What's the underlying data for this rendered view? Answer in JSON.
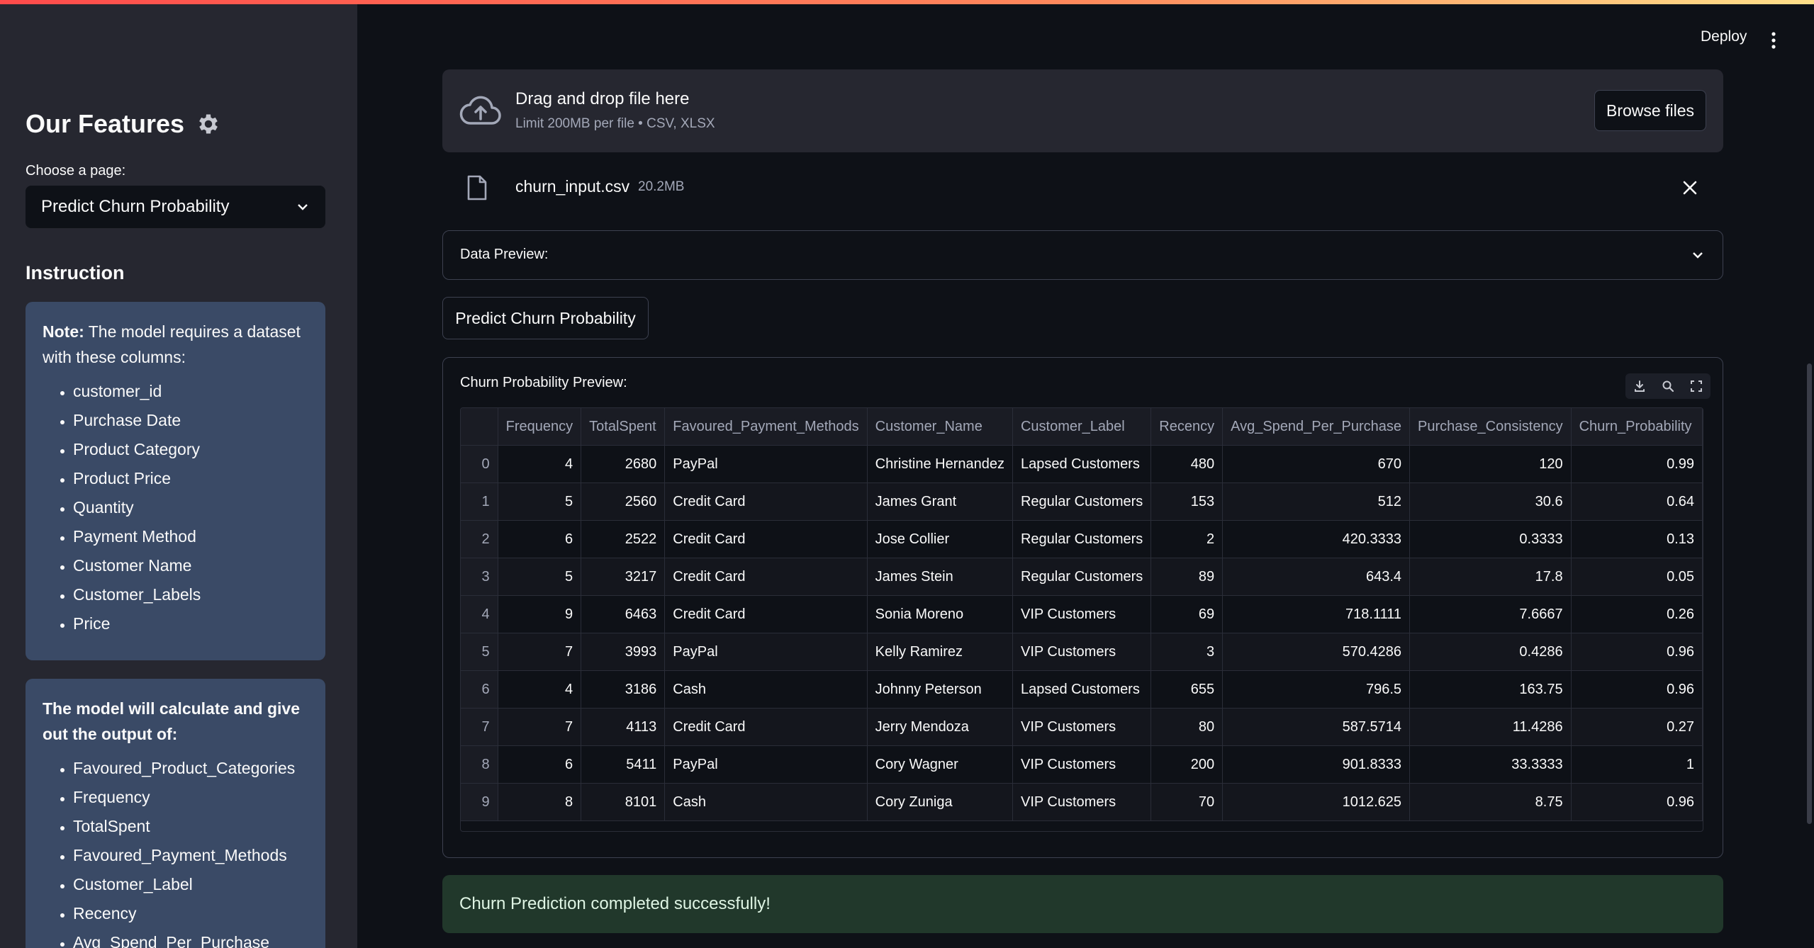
{
  "header": {
    "deploy_label": "Deploy"
  },
  "sidebar": {
    "title": "Our Features",
    "choose_label": "Choose a page:",
    "selected_page": "Predict Churn Probability",
    "instruction_heading": "Instruction",
    "note_prefix": "Note:",
    "note_text": " The model requires a dataset with these columns:",
    "required_columns": [
      "customer_id",
      "Purchase Date",
      "Product Category",
      "Product Price",
      "Quantity",
      "Payment Method",
      "Customer Name",
      "Customer_Labels",
      "Price"
    ],
    "output_heading": "The model will calculate and give out the output of:",
    "output_columns": [
      "Favoured_Product_Categories",
      "Frequency",
      "TotalSpent",
      "Favoured_Payment_Methods",
      "Customer_Label",
      "Recency",
      "Avg_Spend_Per_Purchase"
    ]
  },
  "uploader": {
    "title": "Drag and drop file here",
    "limit": "Limit 200MB per file • CSV, XLSX",
    "browse_label": "Browse files"
  },
  "file": {
    "name": "churn_input.csv",
    "size": "20.2MB"
  },
  "expander": {
    "label": "Data Preview:"
  },
  "predict_button": "Predict Churn Probability",
  "dataframe": {
    "title": "Churn Probability Preview:",
    "columns": [
      "",
      "Frequency",
      "TotalSpent",
      "Favoured_Payment_Methods",
      "Customer_Name",
      "Customer_Label",
      "Recency",
      "Avg_Spend_Per_Purchase",
      "Purchase_Consistency",
      "Churn_Probability"
    ],
    "rows": [
      [
        "0",
        "4",
        "2680",
        "PayPal",
        "Christine Hernandez",
        "Lapsed Customers",
        "480",
        "670",
        "120",
        "0.99"
      ],
      [
        "1",
        "5",
        "2560",
        "Credit Card",
        "James Grant",
        "Regular Customers",
        "153",
        "512",
        "30.6",
        "0.64"
      ],
      [
        "2",
        "6",
        "2522",
        "Credit Card",
        "Jose Collier",
        "Regular Customers",
        "2",
        "420.3333",
        "0.3333",
        "0.13"
      ],
      [
        "3",
        "5",
        "3217",
        "Credit Card",
        "James Stein",
        "Regular Customers",
        "89",
        "643.4",
        "17.8",
        "0.05"
      ],
      [
        "4",
        "9",
        "6463",
        "Credit Card",
        "Sonia Moreno",
        "VIP Customers",
        "69",
        "718.1111",
        "7.6667",
        "0.26"
      ],
      [
        "5",
        "7",
        "3993",
        "PayPal",
        "Kelly Ramirez",
        "VIP Customers",
        "3",
        "570.4286",
        "0.4286",
        "0.96"
      ],
      [
        "6",
        "4",
        "3186",
        "Cash",
        "Johnny Peterson",
        "Lapsed Customers",
        "655",
        "796.5",
        "163.75",
        "0.96"
      ],
      [
        "7",
        "7",
        "4113",
        "Credit Card",
        "Jerry Mendoza",
        "VIP Customers",
        "80",
        "587.5714",
        "11.4286",
        "0.27"
      ],
      [
        "8",
        "6",
        "5411",
        "PayPal",
        "Cory Wagner",
        "VIP Customers",
        "200",
        "901.8333",
        "33.3333",
        "1"
      ],
      [
        "9",
        "8",
        "8101",
        "Cash",
        "Cory Zuniga",
        "VIP Customers",
        "70",
        "1012.625",
        "8.75",
        "0.96"
      ]
    ]
  },
  "success_message": "Churn Prediction completed successfully!"
}
